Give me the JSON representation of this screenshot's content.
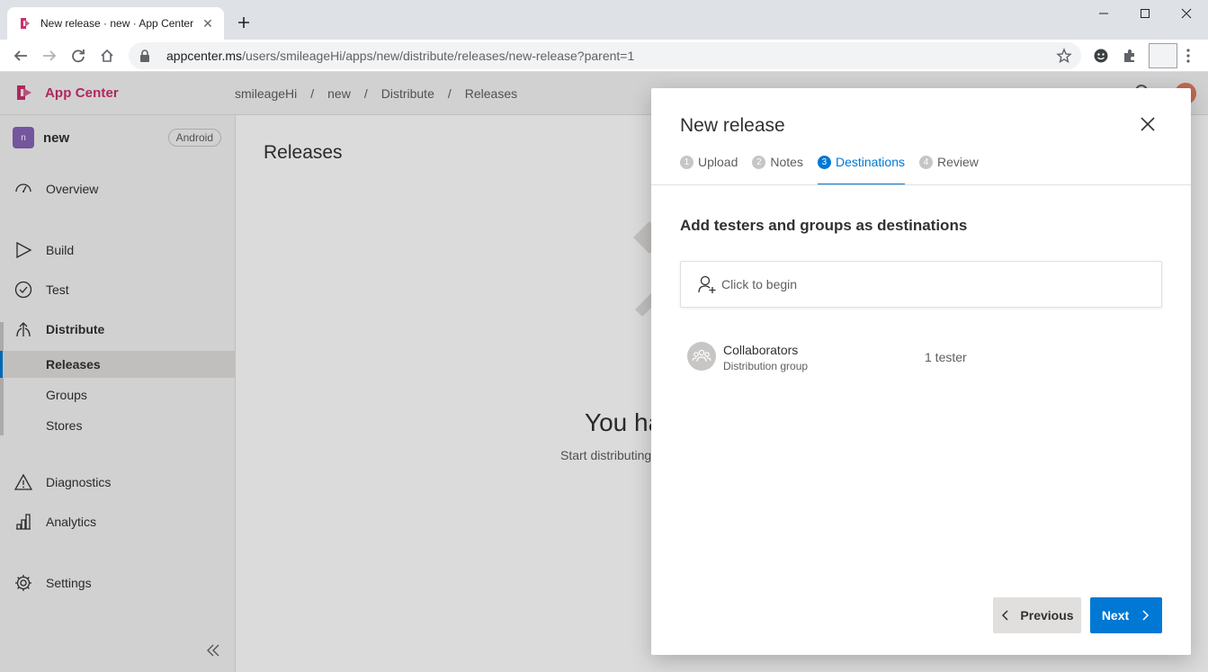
{
  "browser": {
    "tab_title": "New release · new · App Center",
    "url_host": "appcenter.ms",
    "url_path": "/users/smileageHi/apps/new/distribute/releases/new-release?parent=1"
  },
  "header": {
    "brand": "App Center",
    "breadcrumbs": [
      "smileageHi",
      "new",
      "Distribute",
      "Releases"
    ],
    "separator": "/"
  },
  "sidebar": {
    "app_initial": "n",
    "app_name": "new",
    "app_os": "Android",
    "items": {
      "overview": "Overview",
      "build": "Build",
      "test": "Test",
      "distribute": "Distribute",
      "releases": "Releases",
      "groups": "Groups",
      "stores": "Stores",
      "diagnostics": "Diagnostics",
      "analytics": "Analytics",
      "settings": "Settings"
    }
  },
  "main": {
    "title": "Releases",
    "empty_title": "You ha",
    "empty_subtitle": "Start distributing"
  },
  "modal": {
    "title": "New release",
    "steps": [
      {
        "num": "1",
        "label": "Upload"
      },
      {
        "num": "2",
        "label": "Notes"
      },
      {
        "num": "3",
        "label": "Destinations"
      },
      {
        "num": "4",
        "label": "Review"
      }
    ],
    "section_heading": "Add testers and groups as destinations",
    "picker_placeholder": "Click to begin",
    "destination": {
      "name": "Collaborators",
      "type": "Distribution group",
      "count": "1 tester"
    },
    "previous_label": "Previous",
    "next_label": "Next"
  },
  "colors": {
    "brand": "#cb2e6d",
    "accent": "#0078d4",
    "sidebar_bg": "#f4f4f4"
  }
}
